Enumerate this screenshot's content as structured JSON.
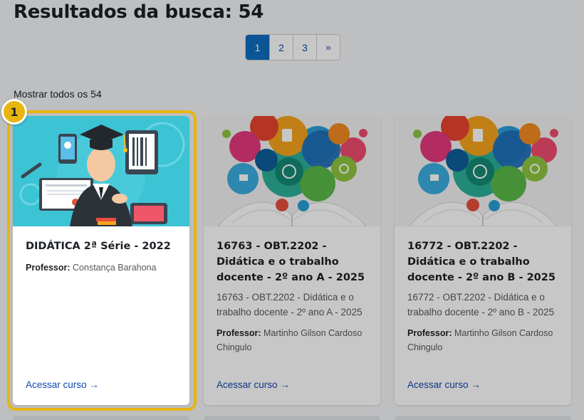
{
  "header": {
    "title": "Resultados da busca: 54"
  },
  "pagination": {
    "pages": [
      "1",
      "2",
      "3"
    ],
    "active": "1",
    "next_label": "»"
  },
  "show_all_label": "Mostrar todos os 54",
  "courses": [
    {
      "title": "DIDÁTICA 2ª Série - 2022",
      "summary": "",
      "teacher_label": "Professor:",
      "teacher": "Constança Barahona",
      "link_label": "Acessar curso →",
      "image": "graduate-illustration"
    },
    {
      "title": "16763 - OBT.2202 - Didática e o trabalho docente - 2º ano A - 2025",
      "summary": "16763 - OBT.2202 - Didática e o trabalho docente - 2º ano A - 2025",
      "teacher_label": "Professor:",
      "teacher": "Martinho Gilson Cardoso Chingulo",
      "link_label": "Acessar curso →",
      "image": "science-book-illustration"
    },
    {
      "title": "16772 - OBT.2202 - Didática e o trabalho docente - 2º ano B - 2025",
      "summary": "16772 - OBT.2202 - Didática e o trabalho docente - 2º ano B - 2025",
      "teacher_label": "Professor:",
      "teacher": "Martinho Gilson Cardoso Chingulo",
      "link_label": "Acessar curso →",
      "image": "science-book-illustration"
    }
  ],
  "tour": {
    "step": "1",
    "highlight_color": "#e8b50f"
  },
  "colors": {
    "accent": "#0f6cbf",
    "link": "#0f47ad",
    "highlight": "#e8b50f"
  }
}
